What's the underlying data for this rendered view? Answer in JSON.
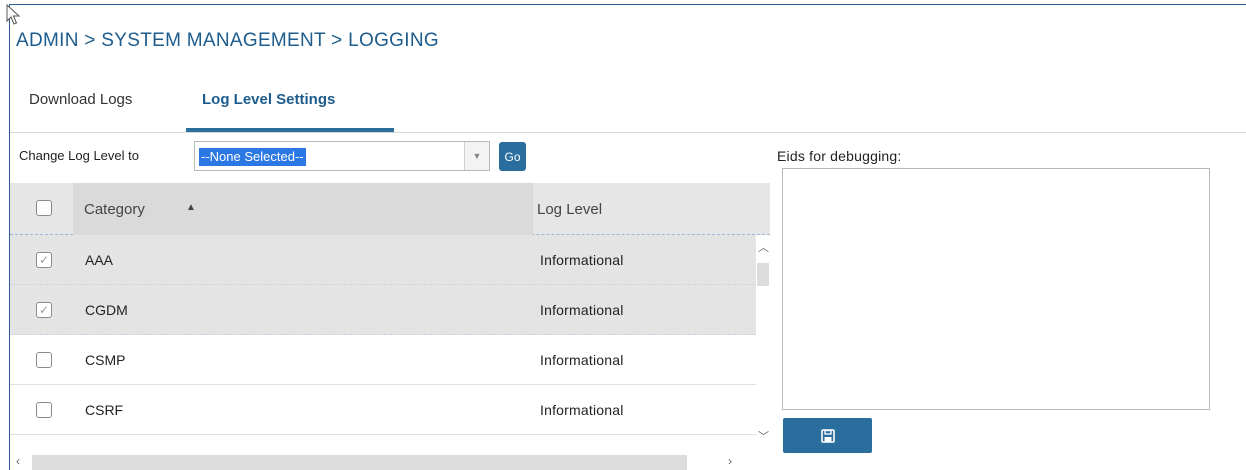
{
  "breadcrumb": "ADMIN > SYSTEM MANAGEMENT > LOGGING",
  "tabs": [
    {
      "label": "Download Logs",
      "active": false
    },
    {
      "label": "Log Level Settings",
      "active": true
    }
  ],
  "change_log_level": {
    "label": "Change Log Level to",
    "selected": "--None Selected--",
    "go_label": "Go"
  },
  "grid": {
    "columns": {
      "category": "Category",
      "log_level": "Log Level"
    },
    "sort": "ascending",
    "rows": [
      {
        "category": "AAA",
        "log_level": "Informational",
        "checked": true
      },
      {
        "category": "CGDM",
        "log_level": "Informational",
        "checked": true
      },
      {
        "category": "CSMP",
        "log_level": "Informational",
        "checked": false
      },
      {
        "category": "CSRF",
        "log_level": "Informational",
        "checked": false
      }
    ]
  },
  "eids": {
    "label": "Eids for debugging:",
    "value": ""
  },
  "icons": {
    "save": "save-icon",
    "sort": "sort-ascending-icon",
    "dropdown": "chevron-down-icon"
  },
  "colors": {
    "accent": "#2a6e9e",
    "breadcrumb": "#1d5c8c",
    "selection": "#2b78e4"
  }
}
